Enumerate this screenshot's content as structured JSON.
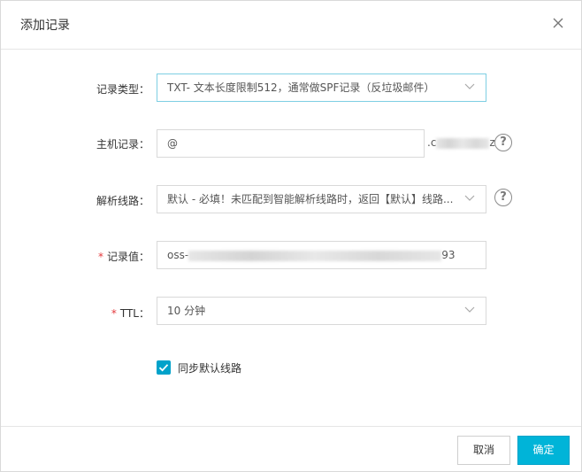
{
  "dialog": {
    "title": "添加记录",
    "close_icon": "close-icon"
  },
  "form": {
    "record_type": {
      "label": "记录类型：",
      "value": "TXT- 文本长度限制512，通常做SPF记录（反垃圾邮件）"
    },
    "host": {
      "label": "主机记录：",
      "value": "@",
      "suffix_start": ".c",
      "suffix_end": "z"
    },
    "line": {
      "label": "解析线路：",
      "value": "默认 - 必填！未匹配到智能解析线路时，返回【默认】线路..."
    },
    "record_value": {
      "label": "记录值：",
      "required_mark": "*",
      "value_start": "oss-",
      "value_end": "93"
    },
    "ttl": {
      "label": "TTL：",
      "required_mark": "*",
      "value": "10 分钟"
    },
    "sync": {
      "label": "同步默认线路",
      "checked": true
    }
  },
  "help_icon_glyph": "?",
  "buttons": {
    "cancel": "取消",
    "ok": "确定"
  },
  "colors": {
    "primary": "#00b4d8",
    "checkbox": "#00a2ca",
    "required": "#e4393c",
    "focus_border": "#7ecfe3"
  }
}
